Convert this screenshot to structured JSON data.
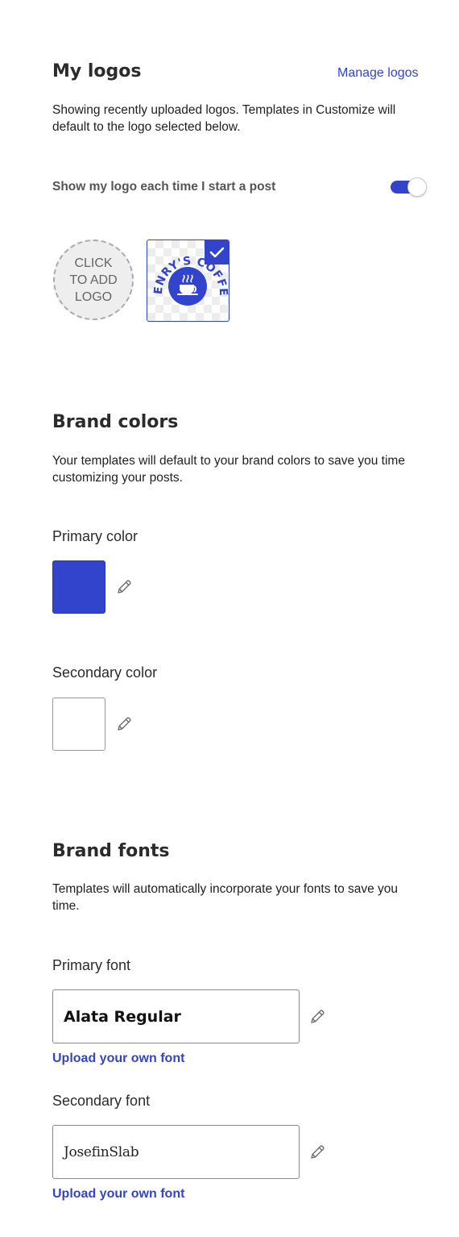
{
  "logos": {
    "title": "My logos",
    "manage_link": "Manage logos",
    "description": "Showing recently uploaded logos. Templates in Customize will default to the logo selected below.",
    "toggle_label": "Show my logo each time I start a post",
    "toggle_on": true,
    "add_logo_lines": [
      "CLICK",
      "TO ADD",
      "LOGO"
    ],
    "selected_logo_text": "HENRY'S COFFEE"
  },
  "colors": {
    "title": "Brand colors",
    "description": "Your templates will default to your brand colors to save you time customizing your posts.",
    "primary_label": "Primary color",
    "primary_value": "#3344cc",
    "secondary_label": "Secondary color",
    "secondary_value": "#ffffff"
  },
  "fonts": {
    "title": "Brand fonts",
    "description": "Templates will automatically incorporate your fonts to save you time.",
    "primary_label": "Primary font",
    "primary_value": "Alata Regular",
    "primary_upload": "Upload your own font",
    "secondary_label": "Secondary font",
    "secondary_value": "JosefinSlab",
    "secondary_upload": "Upload your own font"
  },
  "icons": {
    "pencil": "pencil-icon",
    "check": "check-icon",
    "coffee": "coffee-cup-icon"
  }
}
